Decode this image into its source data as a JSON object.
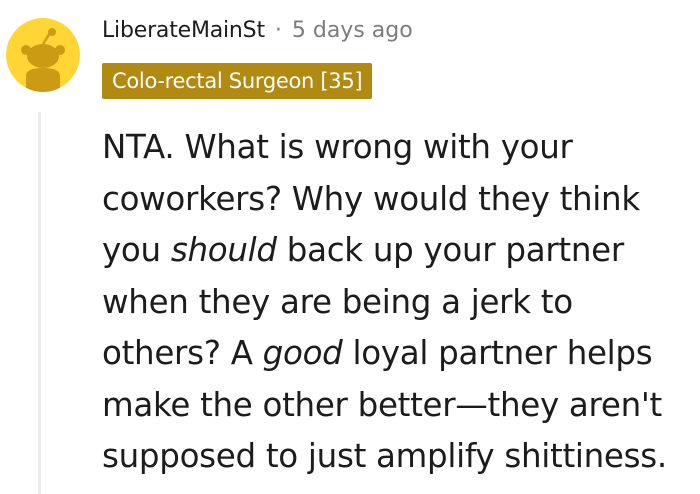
{
  "comment": {
    "author": "LiberateMainSt",
    "separator": "·",
    "timestamp": "5 days ago",
    "flair": "Colo-rectal Surgeon [35]",
    "avatar_icon": "reddit-snoo-avatar-icon",
    "colors": {
      "avatar_bg": "#ffd635",
      "avatar_figure": "#cc9b14",
      "flair_bg": "#b08a12",
      "text": "#1c1c1c",
      "meta_gray": "#7c7c7c",
      "thread_line": "#ededed"
    },
    "body": {
      "l1": "NTA. What is wrong with your",
      "l2": "coworkers? Why would they think",
      "l3_a": "you ",
      "l3_em": "should",
      "l3_b": " back up your partner",
      "l4": "when they are being a jerk to",
      "l5_a": "others? A ",
      "l5_em": "good",
      "l5_b": " loyal partner helps",
      "l6": "make the other better—they aren't",
      "l7": "supposed to just amplify shittiness."
    }
  }
}
